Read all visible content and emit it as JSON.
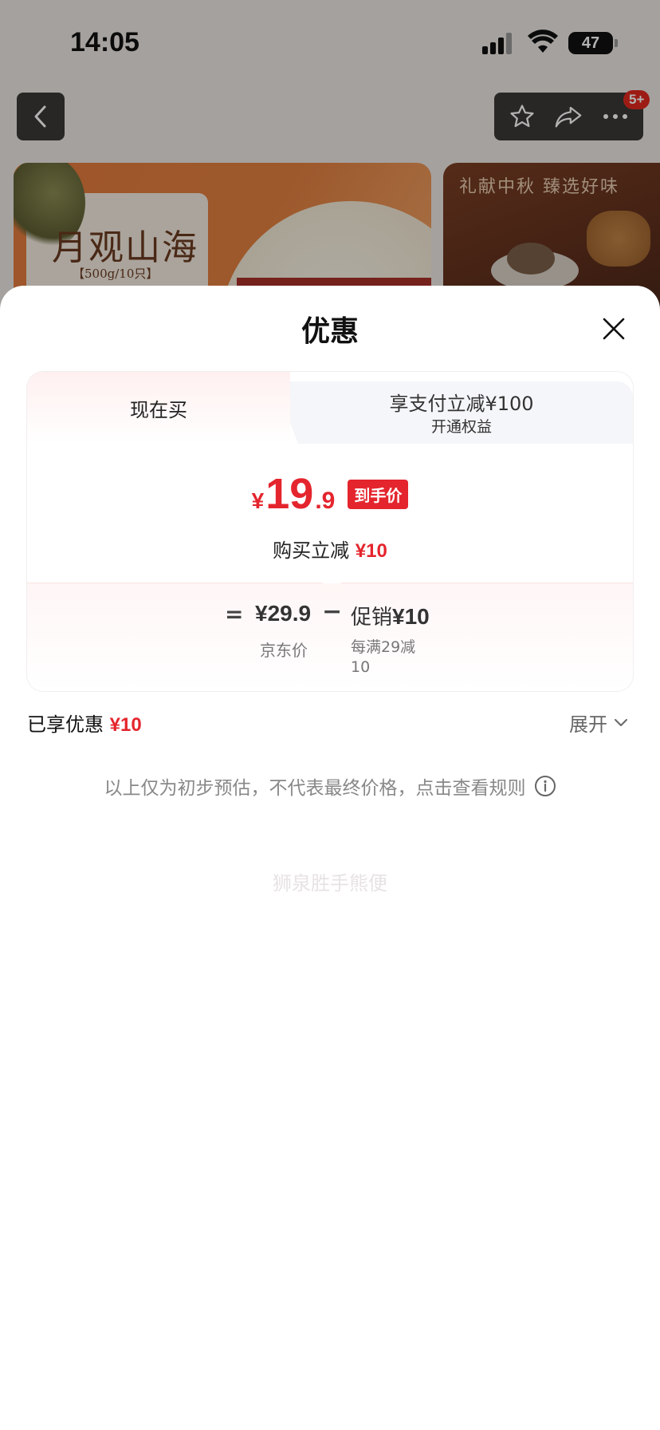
{
  "status_bar": {
    "time": "14:05",
    "battery": "47"
  },
  "background": {
    "badge": "5+",
    "banner_left": {
      "title": "月观山海",
      "subtitle": "【500g/10只】"
    },
    "banner_right": {
      "text": "礼献中秋 臻选好味"
    }
  },
  "sheet": {
    "title": "优惠",
    "tabs": [
      {
        "label": "现在买",
        "active": true
      },
      {
        "label": "享支付立减¥100",
        "sub": "开通权益",
        "active": false
      }
    ],
    "price": {
      "currency": "¥",
      "integer": "19",
      "decimal": ".9",
      "tag": "到手价"
    },
    "reduce": {
      "label": "购买立减",
      "amount": "¥10"
    },
    "breakdown": {
      "equals": "=",
      "jd_price": "¥29.9",
      "jd_label": "京东价",
      "minus": "−",
      "promo_label_prefix": "促销",
      "promo_amount": "¥10",
      "promo_desc": "每满29减10"
    },
    "watermark": "狮泉胜手熊便",
    "enjoyed": {
      "label": "已享优惠",
      "amount": "¥10"
    },
    "expand_label": "展开",
    "disclaimer": "以上仅为初步预估，不代表最终价格，点击查看规则"
  },
  "colors": {
    "accent_red": "#e4252d",
    "overlay": "rgba(0,0,0,0.30)"
  }
}
